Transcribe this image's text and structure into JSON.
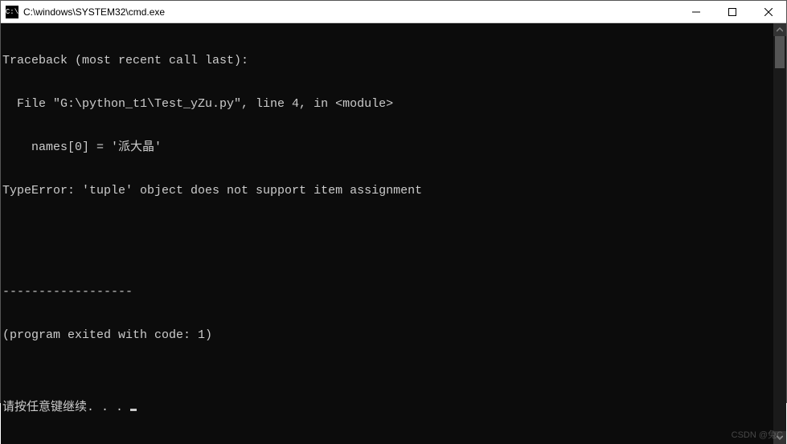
{
  "titlebar": {
    "icon_text": "C:\\",
    "title": "C:\\windows\\SYSTEM32\\cmd.exe"
  },
  "window_controls": {
    "minimize": "minimize",
    "maximize": "maximize",
    "close": "close"
  },
  "console": {
    "lines": [
      "Traceback (most recent call last):",
      "  File \"G:\\python_t1\\Test_yZu.py\", line 4, in <module>",
      "    names[0] = '派大晶'",
      "TypeError: 'tuple' object does not support item assignment",
      "",
      "",
      "------------------",
      "(program exited with code: 1)",
      "",
      "请按任意键继续. . . "
    ]
  },
  "watermark": "CSDN @兔C"
}
